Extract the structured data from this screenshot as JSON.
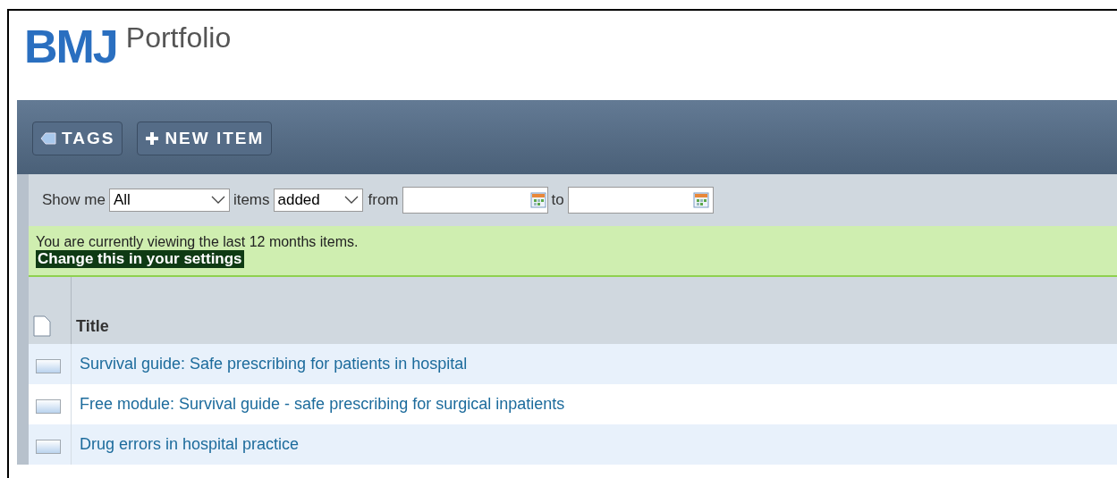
{
  "logo": {
    "mark": "BMJ",
    "product": "Portfolio"
  },
  "toolbar": {
    "buttons": [
      {
        "kind": "tag",
        "label": "TAGS"
      },
      {
        "kind": "add",
        "label": "NEW ITEM"
      }
    ]
  },
  "filter": {
    "show_label": "Show me",
    "show_value": "All",
    "items_label": "items",
    "items_value": "added",
    "from_label": "from",
    "to_label": "to"
  },
  "notice": {
    "text": "You are currently viewing the last 12 months items.",
    "link": "Change this in your settings"
  },
  "table": {
    "columns": [
      "Title"
    ],
    "rows": [
      {
        "title": "Survival guide: Safe prescribing for patients in hospital"
      },
      {
        "title": "Free module: Survival guide - safe prescribing for surgical inpatients"
      },
      {
        "title": "Drug errors in hospital practice"
      }
    ]
  }
}
